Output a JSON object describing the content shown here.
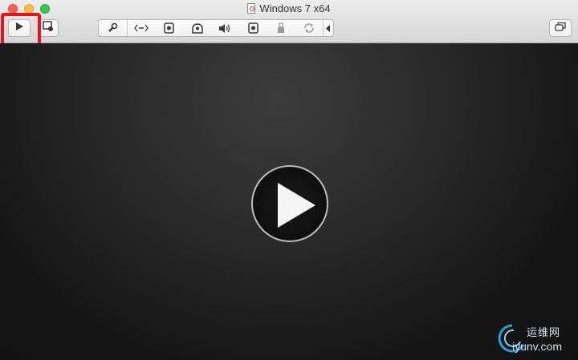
{
  "window": {
    "title": "Windows 7 x64"
  },
  "toolbar": {
    "play": "play-icon",
    "snapshot": "snapshot-icon",
    "group_icons": [
      "wrench-icon",
      "network-icon",
      "hard-disk-icon",
      "optical-drive-icon",
      "sound-icon",
      "camera-icon",
      "usb-icon",
      "sharing-icon"
    ],
    "collapse": "chevron-left-icon",
    "fullscreen": "window-icon"
  },
  "display": {
    "center_button": "play-icon"
  },
  "watermark": {
    "top": "运维网",
    "bottom": "iyunv.com"
  },
  "colors": {
    "highlight": "#e8141b",
    "display_bg": "#1a1a1a"
  }
}
